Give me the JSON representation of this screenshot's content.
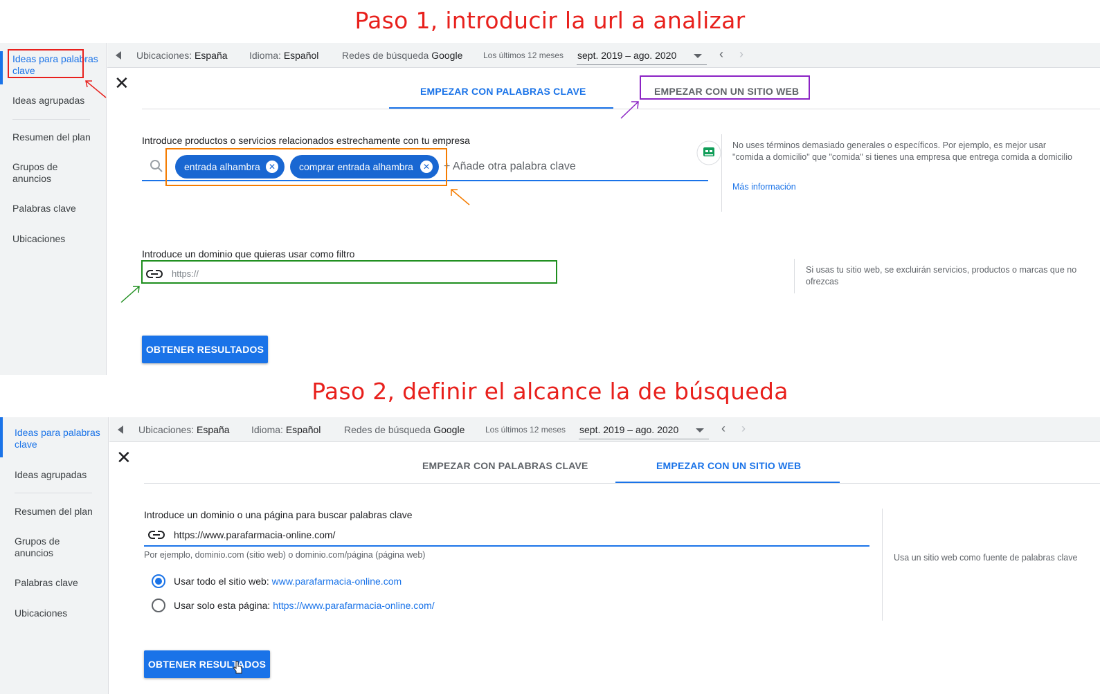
{
  "step1_title": "Paso 1, introducir la url a analizar",
  "step2_title": "Paso 2, definir el alcance la de búsqueda",
  "sidebar": {
    "items": [
      "Ideas para palabras clave",
      "Ideas agrupadas",
      "Resumen del plan",
      "Grupos de anuncios",
      "Palabras clave",
      "Ubicaciones"
    ]
  },
  "topbar": {
    "locations_label": "Ubicaciones:",
    "locations_value": "España",
    "language_label": "Idioma:",
    "language_value": "Español",
    "network_label": "Redes de búsqueda",
    "network_value": "Google",
    "period_label": "Los últimos 12 meses",
    "period_value": "sept. 2019 – ago. 2020"
  },
  "tabs": {
    "keywords": "EMPEZAR CON PALABRAS CLAVE",
    "website": "EMPEZAR CON UN SITIO WEB"
  },
  "step1": {
    "products_label": "Introduce productos o servicios relacionados estrechamente con tu empresa",
    "chips": [
      "entrada alhambra",
      "comprar entrada alhambra"
    ],
    "add_keyword_placeholder": "+ Añade otra palabra clave",
    "tip_text": "No uses términos demasiado generales o específicos. Por ejemplo, es mejor usar \"comida a domicilio\" que \"comida\" si tienes una empresa que entrega comida a domicilio",
    "tip_link": "Más información",
    "domain_label": "Introduce un dominio que quieras usar como filtro",
    "domain_placeholder": "https://",
    "domain_hint": "Si usas tu sitio web, se excluirán servicios, productos o marcas que no ofrezcas",
    "button": "OBTENER RESULTADOS"
  },
  "step2": {
    "domain_label": "Introduce un dominio o una página para buscar palabras clave",
    "domain_value": "https://www.parafarmacia-online.com/",
    "domain_example": "Por ejemplo, dominio.com (sitio web) o dominio.com/página (página web)",
    "radio_all_label": "Usar todo el sitio web:",
    "radio_all_link": "www.parafarmacia-online.com",
    "radio_page_label": "Usar solo esta página:",
    "radio_page_link": "https://www.parafarmacia-online.com/",
    "side_hint": "Usa un sitio web como fuente de palabras clave",
    "button": "OBTENER RESULTADOS"
  },
  "colors": {
    "accent": "#1a73e8",
    "annotation_red": "#e8201c",
    "annotation_purple": "#8b23c4",
    "annotation_orange": "#f57c00",
    "annotation_green": "#1e8e1e"
  }
}
